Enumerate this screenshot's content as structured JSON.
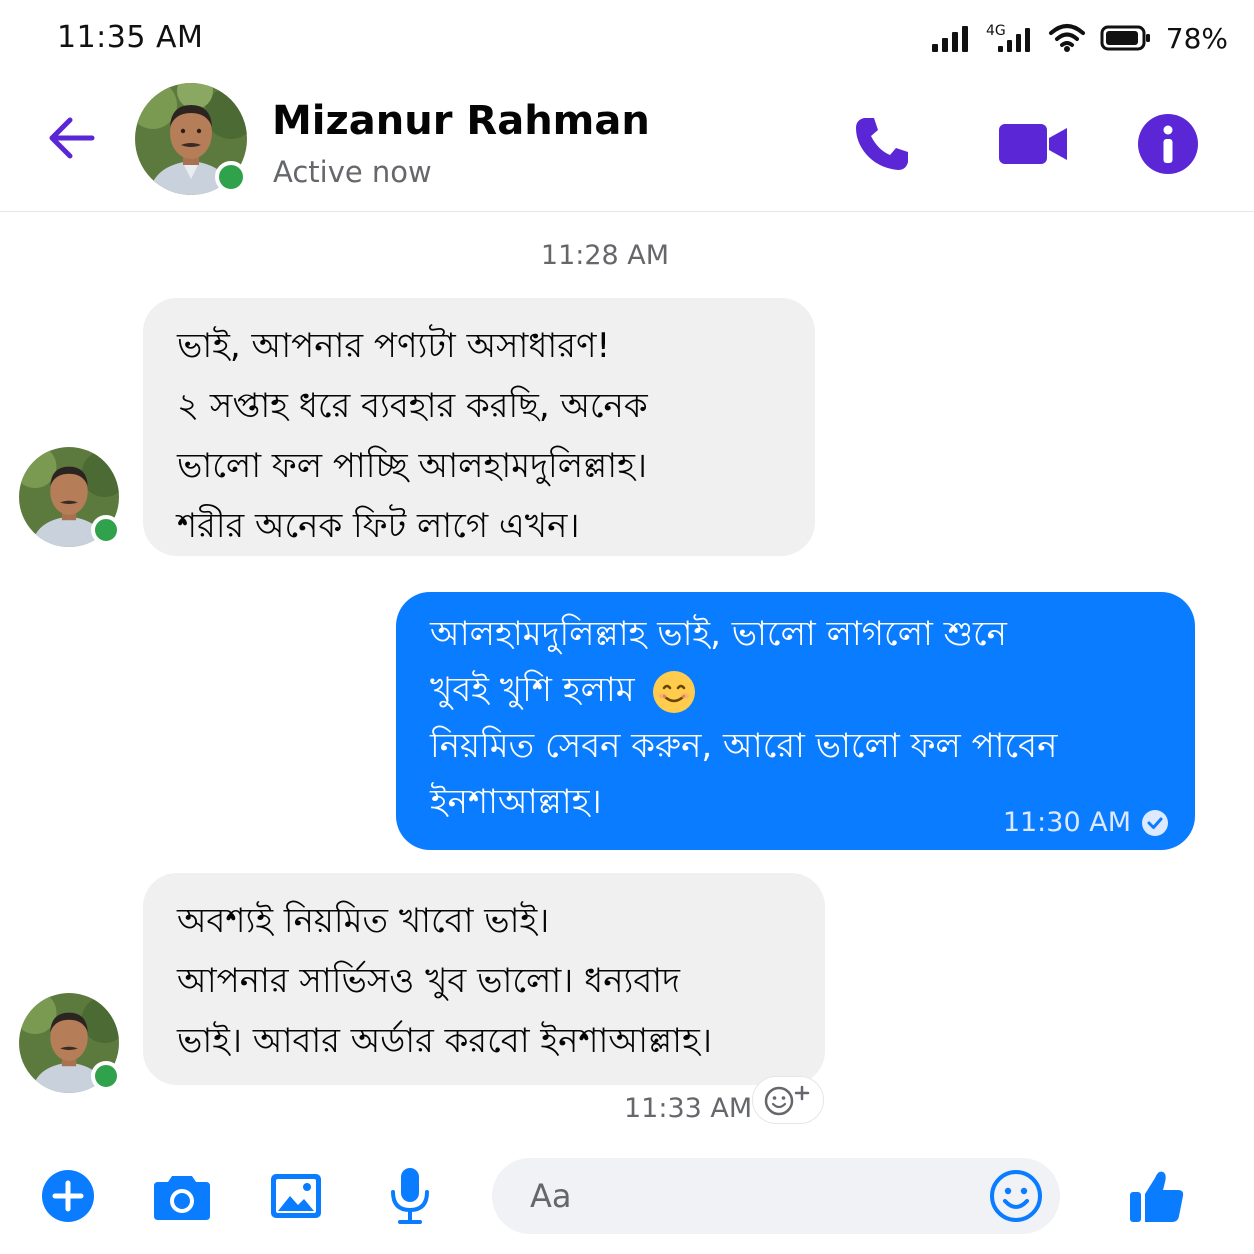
{
  "status_bar": {
    "time": "11:35 AM",
    "network": "4G",
    "battery": "78%"
  },
  "header": {
    "contact_name": "Mizanur Rahman",
    "contact_status": "Active now"
  },
  "colors": {
    "accent": "#5b26d6",
    "messenger_blue": "#0a7cff",
    "incoming_bubble": "#f0f0f0",
    "online_green": "#31a24c"
  },
  "chat": {
    "separator_time": "11:28 AM",
    "messages": [
      {
        "direction": "incoming",
        "lines": [
          "ভাই, আপনার পণ্যটা অসাধারণ!",
          "২ সপ্তাহ ধরে ব্যবহার করছি, অনেক",
          "ভালো ফল পাচ্ছি আলহামদুলিল্লাহ।",
          "শরীর অনেক ফিট লাগে এখন।"
        ]
      },
      {
        "direction": "outgoing",
        "lines": [
          "আলহামদুলিল্লাহ ভাই, ভালো লাগলো শুনে",
          "খুবই খুশি হলাম",
          "নিয়মিত সেবন করুন, আরো ভালো ফল পাবেন",
          "ইনশাআল্লাহ।"
        ],
        "emoji": "smiling-face",
        "time": "11:30 AM",
        "receipt_icon": "check-circle-icon"
      },
      {
        "direction": "incoming",
        "lines": [
          "অবশ্যই নিয়মিত খাবো ভাই।",
          "আপনার সার্ভিসও খুব ভালো। ধন্যবাদ",
          "ভাই। আবার অর্ডার করবো ইনশাআল্লাহ।"
        ],
        "time": "11:33 AM"
      }
    ]
  },
  "composer": {
    "placeholder": "Aa",
    "value": ""
  },
  "icons": {
    "back": "arrow-left-icon",
    "call": "phone-icon",
    "video": "video-camera-icon",
    "info": "info-icon",
    "plus": "plus-circle-icon",
    "camera": "camera-icon",
    "gallery": "image-icon",
    "mic": "microphone-icon",
    "emoji": "emoji-icon",
    "like": "thumbs-up-icon",
    "react": "add-reaction-icon"
  }
}
